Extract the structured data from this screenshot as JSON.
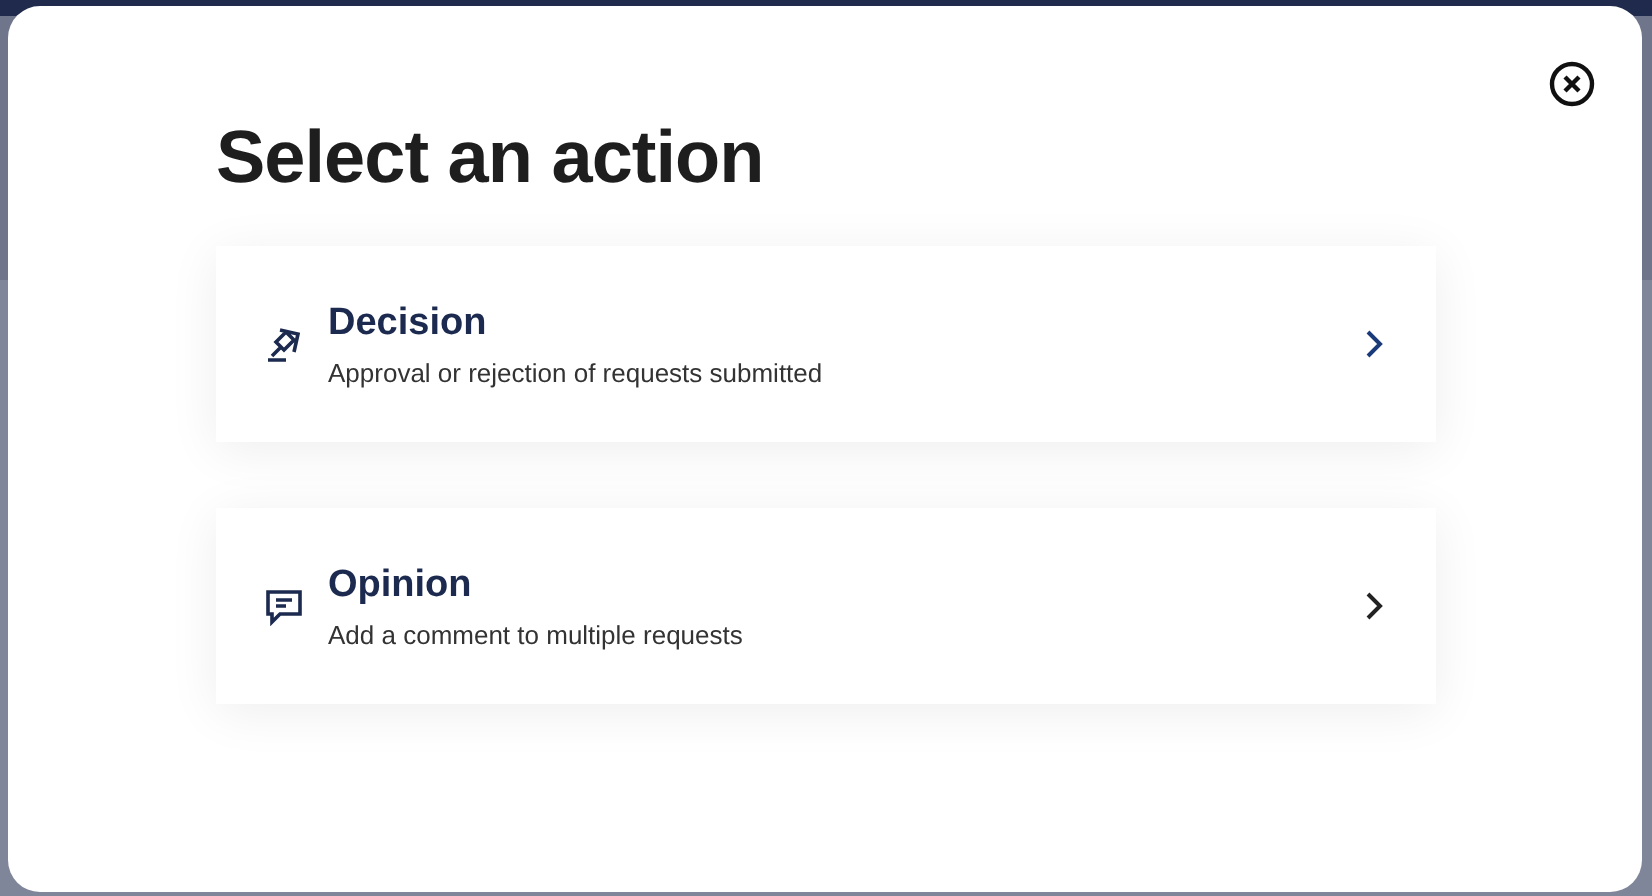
{
  "dialog": {
    "title": "Select an action",
    "actions": [
      {
        "kind": "decision",
        "title": "Decision",
        "description": "Approval or rejection of requests submitted"
      },
      {
        "kind": "opinion",
        "title": "Opinion",
        "description": "Add a comment to multiple requests"
      }
    ]
  }
}
